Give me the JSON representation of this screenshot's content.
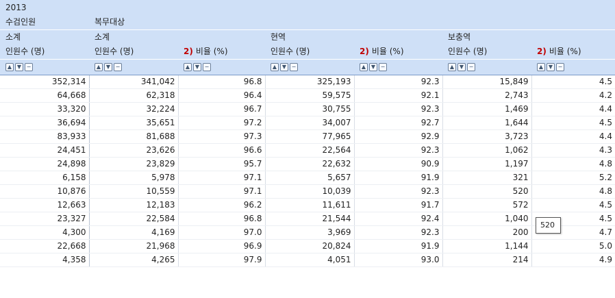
{
  "header": {
    "year": "2013",
    "col_inspected": "수검인원",
    "col_service_target": "복무대상",
    "subtotal": "소계",
    "active": "현역",
    "supplementary": "보충역",
    "count_label": "인원수 (명)",
    "ratio_note": "2)",
    "ratio_label": "비율 (%)",
    "sort_icons": [
      "▲",
      "▼",
      "−"
    ]
  },
  "rows": [
    [
      "352,314",
      "341,042",
      "96.8",
      "325,193",
      "92.3",
      "15,849",
      "4.5"
    ],
    [
      "64,668",
      "62,318",
      "96.4",
      "59,575",
      "92.1",
      "2,743",
      "4.2"
    ],
    [
      "33,320",
      "32,224",
      "96.7",
      "30,755",
      "92.3",
      "1,469",
      "4.4"
    ],
    [
      "36,694",
      "35,651",
      "97.2",
      "34,007",
      "92.7",
      "1,644",
      "4.5"
    ],
    [
      "83,933",
      "81,688",
      "97.3",
      "77,965",
      "92.9",
      "3,723",
      "4.4"
    ],
    [
      "24,451",
      "23,626",
      "96.6",
      "22,564",
      "92.3",
      "1,062",
      "4.3"
    ],
    [
      "24,898",
      "23,829",
      "95.7",
      "22,632",
      "90.9",
      "1,197",
      "4.8"
    ],
    [
      "6,158",
      "5,978",
      "97.1",
      "5,657",
      "91.9",
      "321",
      "5.2"
    ],
    [
      "10,876",
      "10,559",
      "97.1",
      "10,039",
      "92.3",
      "520",
      "4.8"
    ],
    [
      "12,663",
      "12,183",
      "96.2",
      "11,611",
      "91.7",
      "572",
      "4.5"
    ],
    [
      "23,327",
      "22,584",
      "96.8",
      "21,544",
      "92.4",
      "1,040",
      "4.5"
    ],
    [
      "4,300",
      "4,169",
      "97.0",
      "3,969",
      "92.3",
      "200",
      "4.7"
    ],
    [
      "22,668",
      "21,968",
      "96.9",
      "20,824",
      "91.9",
      "1,144",
      "5.0"
    ],
    [
      "4,358",
      "4,265",
      "97.9",
      "4,051",
      "93.0",
      "214",
      "4.9"
    ]
  ],
  "tooltip": "520"
}
